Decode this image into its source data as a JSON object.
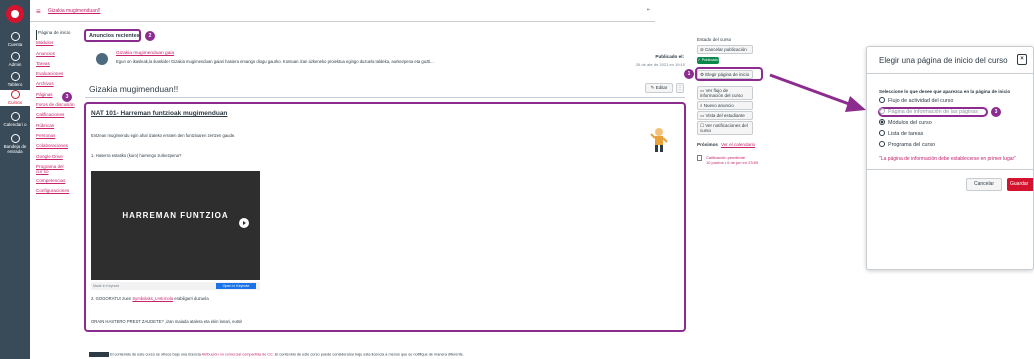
{
  "global_nav": {
    "items": [
      {
        "label": "Cuenta",
        "icon": "user-icon"
      },
      {
        "label": "Admin",
        "icon": "shield-icon"
      },
      {
        "label": "Tablero",
        "icon": "dashboard-icon"
      },
      {
        "label": "Cursos",
        "icon": "book-icon"
      },
      {
        "label": "Calendari o",
        "icon": "calendar-icon"
      },
      {
        "label": "Bandeja de entrada",
        "icon": "inbox-icon"
      }
    ]
  },
  "header": {
    "breadcrumb": "Gizakia mugimenduan!!"
  },
  "course_nav": {
    "items": [
      "Página de inicio",
      "Módulos",
      "Anuncios",
      "Tareas",
      "Evaluaciones",
      "Archivos",
      "Páginas",
      "Foros de discusión",
      "Calificaciones",
      "Rúbricas",
      "Personas",
      "Colaboraciones",
      "Google Drive",
      "Programa del cur so",
      "Competencias",
      "Configuraciones"
    ]
  },
  "announcements": {
    "heading": "Anuncios recientes",
    "step": "2",
    "item": {
      "author": "Gizakia mugimenduan gaia",
      "excerpt": "Egun on ikasleak,la ikaskide! Gizakia mugimenduan gaiari hasiera emango diogu gaurko. Kontuan izan azkeneko proiektua egingo duzuela taldeka, aurkezpena eta guzti...",
      "posted_label": "Publicado el:",
      "date": "26 de abr de 2021 en 19:10"
    }
  },
  "page": {
    "title": "Gizakia mugimenduan!!",
    "edit_label": "✎ Editar",
    "content_title": "NAT 101- Harreman funtzioak mugimenduan",
    "intro": "Entzean mugimendu egin ahal izateko erraten den funtzioaren zertzen gaude.",
    "question": "1. Haserra estatiko (kuro) harrengo zurkezpena?",
    "video_title": "HARREMAN FUNTZIOA",
    "video_made_in": "Made in Keynote",
    "video_open": "Open in Keynote",
    "gogo_prefix": "2. GOGORATU! zuen ",
    "gogo_link": "Symbolaks_LH6.mola",
    "gogo_suffix": " erabilgarri duzuela",
    "orain": "ORAIN HASTERO PREST ZAUDETE? ,izan maiada atalera eta ekin lanari, eutsi!"
  },
  "license": {
    "text": "El contenido de este curso se ofrece bajo una licencia ",
    "link": "Atribución no comercial compartida de CC",
    "suffix": ". El contenido de este curso puede considerarse bajo esta licencia a menos que se notifique de manera diferente."
  },
  "sidebar": {
    "estado_label": "Estado del curso",
    "unpublish": "⊘ Cancelar publicación",
    "published": "✓ Publicado",
    "home_page": "⚙ Elegir página de inicio",
    "home_step": "1",
    "stream": "▭ Ver flujo de información del curso",
    "new_ann": "⌕ Nuevo anuncio",
    "student_view": "▭ Vista del estudiante",
    "notifications": "☐ Ver notificaciones del curso",
    "upcoming": "Próximos",
    "calendar_link": "Ver el calendario",
    "todo": "Calificación pendiente\n10 puntos • 6 de jun en 23:59"
  },
  "dialog": {
    "title": "Elegir una página de inicio del curso",
    "close": "×",
    "prompt": "Seleccione lo que desee que aparezca en la página de inicio",
    "options": [
      {
        "label": "Flujo de actividad del curso",
        "selected": false,
        "disabled": false
      },
      {
        "label": "Página de información de las páginas",
        "selected": false,
        "disabled": true
      },
      {
        "label": "Módulos del curso",
        "selected": true,
        "disabled": false
      },
      {
        "label": "Lista de tareas",
        "selected": false,
        "disabled": false
      },
      {
        "label": "Programa del curso",
        "selected": false,
        "disabled": false
      }
    ],
    "option_step": "3",
    "warning": "\"La página de información debe establecerse en primer lugar\"",
    "cancel": "Cancelar",
    "save": "Guardar"
  },
  "colors": {
    "accent": "#c7236d",
    "highlight": "#8b2c8e",
    "nav": "#394b58",
    "primary": "#d4142f"
  }
}
